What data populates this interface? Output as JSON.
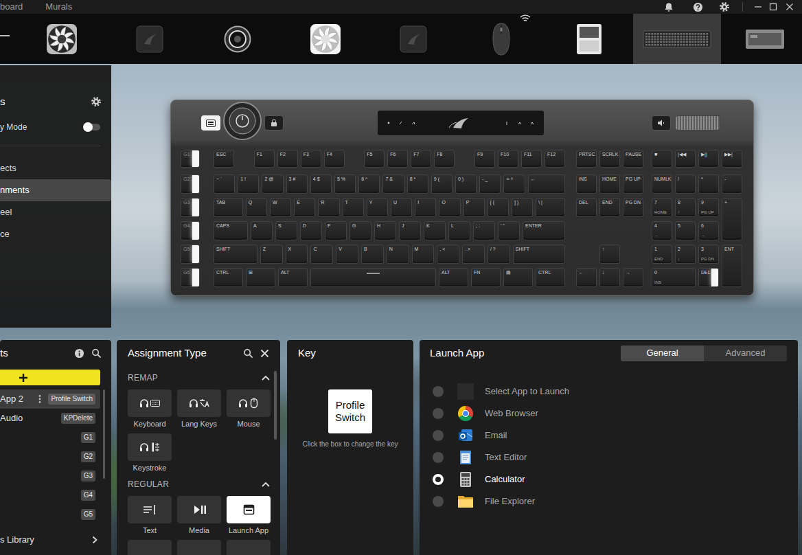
{
  "nav": [
    "board",
    "Murals"
  ],
  "devices": [
    {
      "kind": "fan",
      "selected": false,
      "wireless": false
    },
    {
      "kind": "module",
      "selected": false,
      "wireless": false
    },
    {
      "kind": "pump",
      "selected": false,
      "wireless": false
    },
    {
      "kind": "fan-white",
      "selected": false,
      "wireless": false
    },
    {
      "kind": "module",
      "selected": false,
      "wireless": false
    },
    {
      "kind": "mouse",
      "selected": false,
      "wireless": true
    },
    {
      "kind": "dongle",
      "selected": false,
      "wireless": false
    },
    {
      "kind": "keyboard",
      "selected": true,
      "wireless": false
    },
    {
      "kind": "hub",
      "selected": false,
      "wireless": false
    }
  ],
  "sidebar": {
    "title": "s",
    "toggle": {
      "label": "y Mode",
      "on": false
    },
    "items": [
      {
        "label": "ects",
        "selected": false
      },
      {
        "label": "nments",
        "selected": true
      },
      {
        "label": "eel",
        "selected": false
      },
      {
        "label": "ce",
        "selected": false
      }
    ]
  },
  "keyboard": {
    "gkeys": [
      {
        "label": "G1",
        "lit": true
      },
      {
        "label": "G2",
        "lit": true
      },
      {
        "label": "G3",
        "lit": true
      },
      {
        "label": "G4",
        "lit": true
      },
      {
        "label": "G5",
        "lit": true
      },
      {
        "label": "G6",
        "lit": true
      }
    ],
    "main": [
      [
        [
          {
            "label": "ESC",
            "kind": "key",
            "lit": false
          }
        ],
        [
          {
            "label": "F1",
            "kind": "key",
            "lit": false
          },
          {
            "label": "F2",
            "kind": "key",
            "lit": false
          },
          {
            "label": "F3",
            "kind": "key",
            "lit": false
          },
          {
            "label": "F4",
            "kind": "key",
            "lit": false
          }
        ],
        [
          {
            "label": "F5",
            "kind": "key",
            "lit": false
          },
          {
            "label": "F6",
            "kind": "key",
            "lit": false
          },
          {
            "label": "F7",
            "kind": "key",
            "lit": false
          },
          {
            "label": "F8",
            "kind": "key",
            "lit": false
          }
        ],
        [
          {
            "label": "F9",
            "kind": "key",
            "lit": false
          },
          {
            "label": "F10",
            "kind": "key",
            "lit": false
          },
          {
            "label": "F11",
            "kind": "key",
            "lit": false
          },
          {
            "label": "F12",
            "kind": "key",
            "lit": false
          }
        ]
      ],
      [
        [
          {
            "label": "~ `",
            "kind": "key",
            "lit": false
          },
          {
            "label": "1 !",
            "kind": "key",
            "lit": false
          },
          {
            "label": "2 @",
            "kind": "key",
            "lit": false
          },
          {
            "label": "3 #",
            "kind": "key",
            "lit": false
          },
          {
            "label": "4 $",
            "kind": "key",
            "lit": false
          },
          {
            "label": "5 %",
            "kind": "key",
            "lit": false
          },
          {
            "label": "6 ^",
            "kind": "key",
            "lit": false
          },
          {
            "label": "7 &",
            "kind": "key",
            "lit": false
          },
          {
            "label": "8 *",
            "kind": "key",
            "lit": false
          },
          {
            "label": "9 (",
            "kind": "key",
            "lit": false
          },
          {
            "label": "0 )",
            "kind": "key",
            "lit": false
          },
          {
            "label": "- _",
            "kind": "key",
            "lit": false
          },
          {
            "label": "= +",
            "kind": "key",
            "lit": false
          },
          {
            "label": "←",
            "kind": "back",
            "lit": false
          }
        ]
      ],
      [
        [
          {
            "label": "TAB",
            "kind": "tab",
            "lit": false
          },
          {
            "label": "Q",
            "kind": "key",
            "lit": false
          },
          {
            "label": "W",
            "kind": "key",
            "lit": false
          },
          {
            "label": "E",
            "kind": "key",
            "lit": false
          },
          {
            "label": "R",
            "kind": "key",
            "lit": false
          },
          {
            "label": "T",
            "kind": "key",
            "lit": false
          },
          {
            "label": "Y",
            "kind": "key",
            "lit": false
          },
          {
            "label": "U",
            "kind": "key",
            "lit": false
          },
          {
            "label": "I",
            "kind": "key",
            "lit": false
          },
          {
            "label": "O",
            "kind": "key",
            "lit": false
          },
          {
            "label": "P",
            "kind": "key",
            "lit": false
          },
          {
            "label": "[ {",
            "kind": "key",
            "lit": false
          },
          {
            "label": "] }",
            "kind": "key",
            "lit": false
          },
          {
            "label": "\\ |",
            "kind": "tab",
            "lit": false
          }
        ]
      ],
      [
        [
          {
            "label": "CAPS",
            "kind": "caps",
            "lit": false
          },
          {
            "label": "A",
            "kind": "key",
            "lit": false
          },
          {
            "label": "S",
            "kind": "key",
            "lit": false
          },
          {
            "label": "D",
            "kind": "key",
            "lit": false
          },
          {
            "label": "F",
            "kind": "key",
            "lit": false
          },
          {
            "label": "G",
            "kind": "key",
            "lit": false
          },
          {
            "label": "H",
            "kind": "key",
            "lit": false
          },
          {
            "label": "J",
            "kind": "key",
            "lit": false
          },
          {
            "label": "K",
            "kind": "key",
            "lit": false
          },
          {
            "label": "L",
            "kind": "key",
            "lit": false
          },
          {
            "label": "; :",
            "kind": "key",
            "lit": false
          },
          {
            "label": "' \"",
            "kind": "key",
            "lit": false
          },
          {
            "label": "ENTER",
            "kind": "enter",
            "lit": false
          }
        ]
      ],
      [
        [
          {
            "label": "SHIFT",
            "kind": "lshift",
            "lit": false
          },
          {
            "label": "Z",
            "kind": "key",
            "lit": false
          },
          {
            "label": "X",
            "kind": "key",
            "lit": false
          },
          {
            "label": "C",
            "kind": "key",
            "lit": false
          },
          {
            "label": "V",
            "kind": "key",
            "lit": false
          },
          {
            "label": "B",
            "kind": "key",
            "lit": false
          },
          {
            "label": "N",
            "kind": "key",
            "lit": false
          },
          {
            "label": "M",
            "kind": "key",
            "lit": false
          },
          {
            "label": ", <",
            "kind": "key",
            "lit": false
          },
          {
            "label": ". >",
            "kind": "key",
            "lit": false
          },
          {
            "label": "/ ?",
            "kind": "key",
            "lit": false
          },
          {
            "label": "SHIFT",
            "kind": "rshift",
            "lit": false
          }
        ]
      ],
      [
        [
          {
            "label": "CTRL",
            "kind": "mod",
            "lit": false
          },
          {
            "label": "⊞",
            "kind": "mod",
            "lit": false
          },
          {
            "label": "ALT",
            "kind": "mod",
            "lit": false
          },
          {
            "kind": "space",
            "lit": false
          },
          {
            "label": "ALT",
            "kind": "mod",
            "lit": false
          },
          {
            "label": "FN",
            "kind": "mod",
            "lit": false
          },
          {
            "label": "▤",
            "kind": "mod",
            "lit": false
          },
          {
            "label": "CTRL",
            "kind": "mod",
            "lit": false
          }
        ]
      ]
    ],
    "nav": [
      [
        {
          "label": "PRTSC",
          "lit": false
        },
        {
          "label": "SCRLK",
          "lit": false
        },
        {
          "label": "PAUSE",
          "lit": false
        }
      ],
      [
        {
          "label": "INS",
          "lit": false
        },
        {
          "label": "HOME",
          "lit": false
        },
        {
          "label": "PG UP",
          "lit": false
        }
      ],
      [
        {
          "label": "DEL",
          "lit": false
        },
        {
          "label": "END",
          "lit": false
        },
        {
          "label": "PG DN",
          "lit": false
        }
      ],
      [],
      [
        {
          "label": "↑",
          "lit": false
        }
      ],
      [
        {
          "label": "←",
          "lit": false
        },
        {
          "label": "↓",
          "lit": false
        },
        {
          "label": "→",
          "lit": false
        }
      ]
    ],
    "media": [
      {
        "label": "■",
        "lit": false
      },
      {
        "label": "|◀◀",
        "lit": false
      },
      {
        "label": "▶||",
        "lit": false
      },
      {
        "label": "▶▶|",
        "lit": false
      }
    ],
    "numpad": [
      {
        "label": "NUMLK",
        "kind": "key",
        "lit": false
      },
      {
        "label": "/",
        "kind": "key",
        "lit": false
      },
      {
        "label": "*",
        "kind": "key",
        "lit": false
      },
      {
        "label": "-",
        "kind": "key",
        "lit": false
      },
      {
        "label": "7",
        "sub": "HOME",
        "kind": "key",
        "lit": false
      },
      {
        "label": "8",
        "sub": "↑",
        "kind": "key",
        "lit": false
      },
      {
        "label": "9",
        "sub": "PG UP",
        "kind": "key",
        "lit": false
      },
      {
        "label": "+",
        "kind": "tall",
        "lit": false
      },
      {
        "label": "4",
        "sub": "←",
        "kind": "key",
        "lit": false
      },
      {
        "label": "5",
        "kind": "key",
        "lit": false
      },
      {
        "label": "6",
        "sub": "→",
        "kind": "key",
        "lit": false
      },
      {
        "label": "1",
        "sub": "END",
        "kind": "key",
        "lit": false
      },
      {
        "label": "2",
        "sub": "↓",
        "kind": "key",
        "lit": false
      },
      {
        "label": "3",
        "sub": "PG DN",
        "kind": "key",
        "lit": false
      },
      {
        "label": "ENT",
        "kind": "tall",
        "lit": false
      },
      {
        "label": "0",
        "sub": "INS",
        "kind": "wide",
        "lit": false
      },
      {
        "label": "DEL",
        "kind": "key",
        "lit": true
      }
    ]
  },
  "assignments": {
    "title": "ts",
    "items": [
      {
        "name": "App 2",
        "badge": "Profile Switch",
        "selected": true
      },
      {
        "name": "Audio",
        "badge": "KPDelete",
        "selected": false
      },
      {
        "badge": "G1",
        "selected": false
      },
      {
        "badge": "G2",
        "selected": false
      },
      {
        "badge": "G3",
        "selected": false
      },
      {
        "badge": "G4",
        "selected": false
      },
      {
        "badge": "G5",
        "selected": false
      }
    ],
    "library": "s Library"
  },
  "assignment_type": {
    "title": "Assignment Type",
    "sections": [
      {
        "label": "REMAP",
        "expanded": true,
        "tiles": [
          {
            "label": "Keyboard",
            "kind": "keyboard",
            "selected": false
          },
          {
            "label": "Lang Keys",
            "kind": "lang",
            "selected": false
          },
          {
            "label": "Mouse",
            "kind": "mouse",
            "selected": false
          },
          {
            "label": "Keystroke",
            "kind": "keystroke",
            "selected": false
          }
        ]
      },
      {
        "label": "REGULAR",
        "expanded": true,
        "tiles": [
          {
            "label": "Text",
            "kind": "text",
            "selected": false
          },
          {
            "label": "Media",
            "kind": "media",
            "selected": false
          },
          {
            "label": "Launch App",
            "kind": "launch",
            "selected": true
          }
        ]
      }
    ]
  },
  "key_panel": {
    "title": "Key",
    "key": "Profile Switch",
    "hint": "Click the box to change the key"
  },
  "launch_app": {
    "title": "Launch App",
    "tabs": [
      {
        "label": "General",
        "selected": true
      },
      {
        "label": "Advanced",
        "selected": false
      }
    ],
    "options": [
      {
        "label": "Select App to Launch",
        "kind": "blank",
        "selected": false
      },
      {
        "label": "Web Browser",
        "kind": "browser",
        "selected": false
      },
      {
        "label": "Email",
        "kind": "email",
        "selected": false
      },
      {
        "label": "Text Editor",
        "kind": "editor",
        "selected": false
      },
      {
        "label": "Calculator",
        "kind": "calculator",
        "selected": true
      },
      {
        "label": "File Explorer",
        "kind": "folder",
        "selected": false
      }
    ]
  }
}
